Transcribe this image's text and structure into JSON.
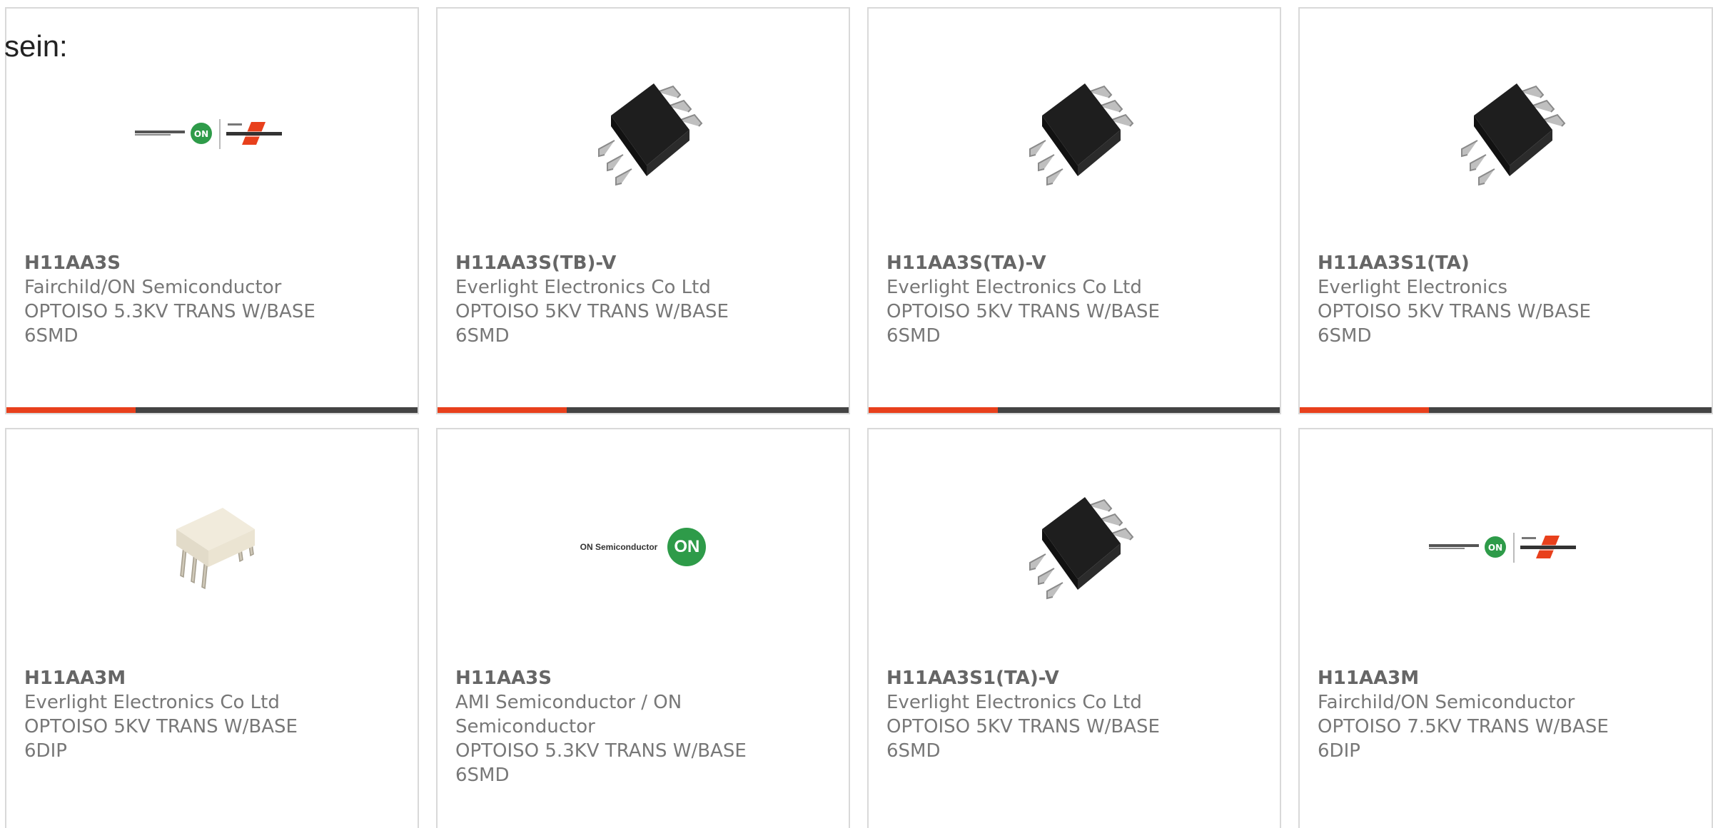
{
  "intro_text": "sein:",
  "colors": {
    "accent": "#e8401c",
    "bar": "#444444",
    "border": "#d9d9d9",
    "text": "#777777"
  },
  "products": [
    {
      "part_number": "H11AA3S",
      "manufacturer": "Fairchild/ON Semiconductor",
      "description": "OPTOISO 5.3KV TRANS W/BASE 6SMD",
      "image": "on-fairchild-logo"
    },
    {
      "part_number": "H11AA3S(TB)-V",
      "manufacturer": "Everlight Electronics Co Ltd",
      "description": "OPTOISO 5KV TRANS W/BASE 6SMD",
      "image": "black-6smd-chip"
    },
    {
      "part_number": "H11AA3S(TA)-V",
      "manufacturer": "Everlight Electronics Co Ltd",
      "description": "OPTOISO 5KV TRANS W/BASE 6SMD",
      "image": "black-6smd-chip"
    },
    {
      "part_number": "H11AA3S1(TA)",
      "manufacturer": "Everlight Electronics",
      "description": "OPTOISO 5KV TRANS W/BASE 6SMD",
      "image": "black-6smd-chip"
    },
    {
      "part_number": "H11AA3M",
      "manufacturer": "Everlight Electronics Co Ltd",
      "description": "OPTOISO 5KV TRANS W/BASE 6DIP",
      "image": "white-6dip-chip"
    },
    {
      "part_number": "H11AA3S",
      "manufacturer": "AMI Semiconductor / ON Semiconductor",
      "description": "OPTOISO 5.3KV TRANS W/BASE 6SMD",
      "image": "on-semiconductor-logo",
      "logo_text": "ON Semiconductor",
      "logo_badge": "ON"
    },
    {
      "part_number": "H11AA3S1(TA)-V",
      "manufacturer": "Everlight Electronics Co Ltd",
      "description": "OPTOISO 5KV TRANS W/BASE 6SMD",
      "image": "black-6smd-chip"
    },
    {
      "part_number": "H11AA3M",
      "manufacturer": "Fairchild/ON Semiconductor",
      "description": "OPTOISO 7.5KV TRANS W/BASE 6DIP",
      "image": "on-fairchild-logo"
    }
  ]
}
